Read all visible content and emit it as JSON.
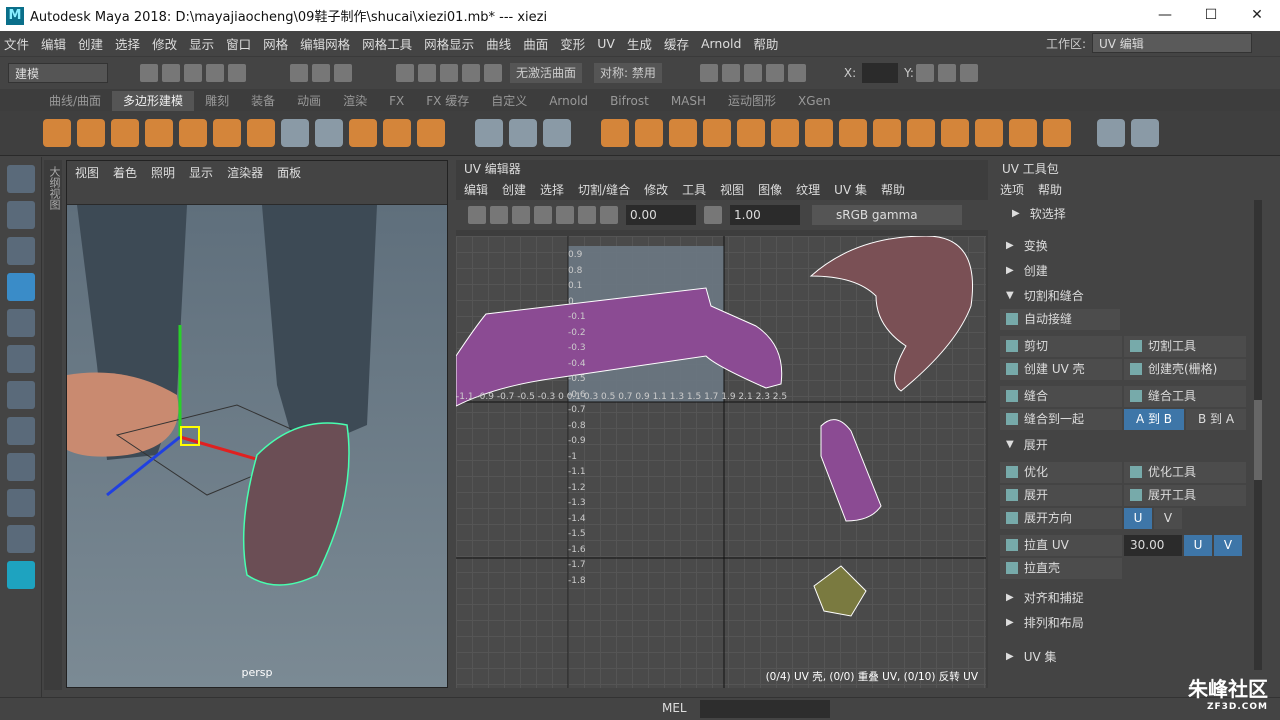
{
  "window": {
    "title": "Autodesk Maya 2018: D:\\mayajiaocheng\\09鞋子制作\\shucai\\xiezi01.mb*   ---   xiezi",
    "logo": "M",
    "minimize": "—",
    "maximize": "☐",
    "close": "✕"
  },
  "menu": [
    "文件",
    "编辑",
    "创建",
    "选择",
    "修改",
    "显示",
    "窗口",
    "网格",
    "编辑网格",
    "网格工具",
    "网格显示",
    "曲线",
    "曲面",
    "变形",
    "UV",
    "生成",
    "缓存",
    "Arnold",
    "帮助"
  ],
  "workspace": {
    "label": "工作区:",
    "value": "UV 编辑"
  },
  "status": {
    "mode": "建模",
    "surface": "无激活曲面",
    "symmetry": "对称: 禁用",
    "x_label": "X:",
    "y_label": "Y:"
  },
  "shelf_tabs": [
    "曲线/曲面",
    "多边形建模",
    "雕刻",
    "装备",
    "动画",
    "渲染",
    "FX",
    "FX 缓存",
    "自定义",
    "Arnold",
    "Bifrost",
    "MASH",
    "运动图形",
    "XGen"
  ],
  "shelf_active": "多边形建模",
  "sidetab": "大纲视图",
  "viewport": {
    "menu": [
      "视图",
      "着色",
      "照明",
      "显示",
      "渲染器",
      "面板"
    ],
    "camera": "persp"
  },
  "uv_editor": {
    "title": "UV 编辑器",
    "menu": [
      "编辑",
      "创建",
      "选择",
      "切割/缝合",
      "修改",
      "工具",
      "视图",
      "图像",
      "纹理",
      "UV 集",
      "帮助"
    ],
    "exposure": "0.00",
    "gamma": "1.00",
    "colorspace": "sRGB gamma",
    "info": "(0/4) UV 壳, (0/0) 重叠 UV, (0/10) 反转 UV",
    "axis_y": [
      "0.9",
      "0.8",
      "0.1",
      "0",
      "-0.1",
      "-0.2",
      "-0.3",
      "-0.4",
      "-0.5",
      "-0.6",
      "-0.7",
      "-0.8",
      "-0.9",
      "-1",
      "-1.1",
      "-1.2",
      "-1.3",
      "-1.4",
      "-1.5",
      "-1.6",
      "-1.7",
      "-1.8"
    ],
    "axis_x": "-1.1 -0.9 -0.7 -0.5 -0.3 0   0.1 0.3 0.5 0.7 0.9 1.1 1.3 1.5 1.7 1.9 2.1 2.3 2.5"
  },
  "toolkit": {
    "title": "UV 工具包",
    "menu": [
      "选项",
      "帮助"
    ],
    "sections": {
      "soft": "软选择",
      "transform": "变换",
      "create": "创建",
      "cutsew": "切割和缝合",
      "unfold": "展开",
      "align": "对齐和捕捉",
      "arrange": "排列和布局",
      "uvset": "UV 集"
    },
    "auto_seams": "自动接缝",
    "cut": "剪切",
    "cut_tool": "切割工具",
    "create_shell": "创建 UV 壳",
    "create_shell_grid": "创建壳(栅格)",
    "sew": "缝合",
    "sew_tool": "缝合工具",
    "sew_together": "缝合到一起",
    "a_to_b": "A 到 B",
    "b_to_a": "B 到 A",
    "optimize": "优化",
    "optimize_tool": "优化工具",
    "unfold": "展开",
    "unfold_tool": "展开工具",
    "unfold_dir": "展开方向",
    "u": "U",
    "v": "V",
    "straighten_uv": "拉直 UV",
    "straighten_value": "30.00",
    "straighten_shell": "拉直壳"
  },
  "cmdline": {
    "mel": "MEL"
  },
  "watermark": {
    "big": "朱峰社区",
    "small": "ZF3D.COM"
  }
}
